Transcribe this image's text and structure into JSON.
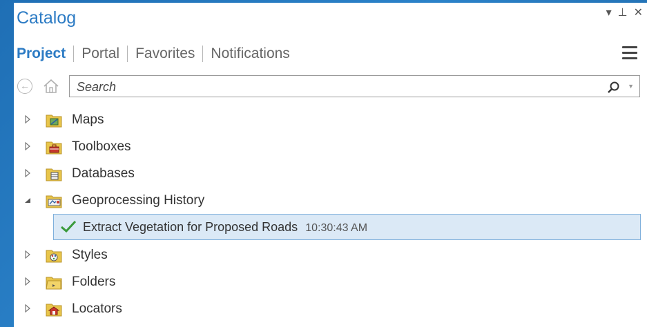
{
  "pane": {
    "title": "Catalog",
    "controls": {
      "dropdown": "▾",
      "pin": "⊥",
      "close": "✕"
    }
  },
  "tabs": [
    {
      "label": "Project",
      "active": true
    },
    {
      "label": "Portal",
      "active": false
    },
    {
      "label": "Favorites",
      "active": false
    },
    {
      "label": "Notifications",
      "active": false
    }
  ],
  "search": {
    "placeholder": "Search",
    "value": ""
  },
  "tree": {
    "items": [
      {
        "label": "Maps",
        "icon": "maps-folder-icon",
        "expanded": false
      },
      {
        "label": "Toolboxes",
        "icon": "toolboxes-folder-icon",
        "expanded": false
      },
      {
        "label": "Databases",
        "icon": "databases-folder-icon",
        "expanded": false
      },
      {
        "label": "Geoprocessing History",
        "icon": "geoprocessing-history-folder-icon",
        "expanded": true
      },
      {
        "label": "Styles",
        "icon": "styles-folder-icon",
        "expanded": false
      },
      {
        "label": "Folders",
        "icon": "folders-folder-icon",
        "expanded": false
      },
      {
        "label": "Locators",
        "icon": "locators-folder-icon",
        "expanded": false
      }
    ],
    "history": [
      {
        "label": "Extract Vegetation for Proposed Roads",
        "time": "10:30:43 AM",
        "status": "success"
      }
    ]
  },
  "colors": {
    "accent": "#2c7bc4",
    "selection_bg": "#dbe9f6",
    "success": "#3a9a3a",
    "folder": "#e8c54a"
  }
}
